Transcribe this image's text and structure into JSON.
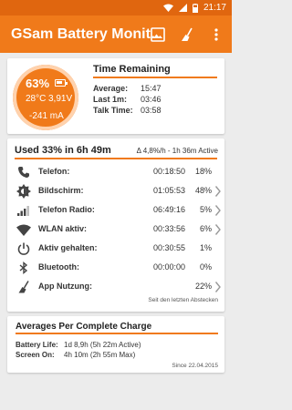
{
  "status_bar": {
    "time": "21:17",
    "icons": [
      "wifi-icon",
      "signal-icon",
      "battery-icon"
    ]
  },
  "app_bar": {
    "title": "GSam Battery Monit…",
    "actions": [
      "image-icon",
      "broom-icon",
      "more-vert-icon"
    ]
  },
  "summary": {
    "percent": "63%",
    "battery_level": 0.63,
    "temperature": "28°C",
    "voltage": "3,91V",
    "current": "-241 mA",
    "title": "Time Remaining",
    "rows": [
      {
        "label": "Average:",
        "value": "15:47"
      },
      {
        "label": "Last 1m:",
        "value": "03:46"
      },
      {
        "label": "Talk Time:",
        "value": "03:58"
      }
    ]
  },
  "usage": {
    "title": "Used 33% in 6h 49m",
    "rate": "Δ 4,8%/h - 1h 36m Active",
    "rows": [
      {
        "icon": "phone-icon",
        "label": "Telefon:",
        "time": "00:18:50",
        "pct": "18%",
        "chevron": false
      },
      {
        "icon": "brightness-icon",
        "label": "Bildschirm:",
        "time": "01:05:53",
        "pct": "48%",
        "chevron": true
      },
      {
        "icon": "signal-bars-icon",
        "label": "Telefon Radio:",
        "time": "06:49:16",
        "pct": "5%",
        "chevron": true
      },
      {
        "icon": "wifi-icon",
        "label": "WLAN aktiv:",
        "time": "00:33:56",
        "pct": "6%",
        "chevron": true
      },
      {
        "icon": "power-icon",
        "label": "Aktiv gehalten:",
        "time": "00:30:55",
        "pct": "1%",
        "chevron": false
      },
      {
        "icon": "bluetooth-icon",
        "label": "Bluetooth:",
        "time": "00:00:00",
        "pct": "0%",
        "chevron": false
      },
      {
        "icon": "broom-icon",
        "label": "App Nutzung:",
        "time": "",
        "pct": "22%",
        "chevron": true
      }
    ],
    "footer": "Seit den letzten Abstecken"
  },
  "averages": {
    "title": "Averages Per Complete Charge",
    "rows": [
      {
        "label": "Battery Life:",
        "value": "1d 8,9h (5h 22m Active)"
      },
      {
        "label": "Screen On:",
        "value": "4h 10m (2h 55m Max)"
      }
    ],
    "since": "Since 22.04.2015"
  },
  "colors": {
    "accent": "#f07a1a",
    "status_bar": "#e0660f",
    "background": "#ececec"
  }
}
